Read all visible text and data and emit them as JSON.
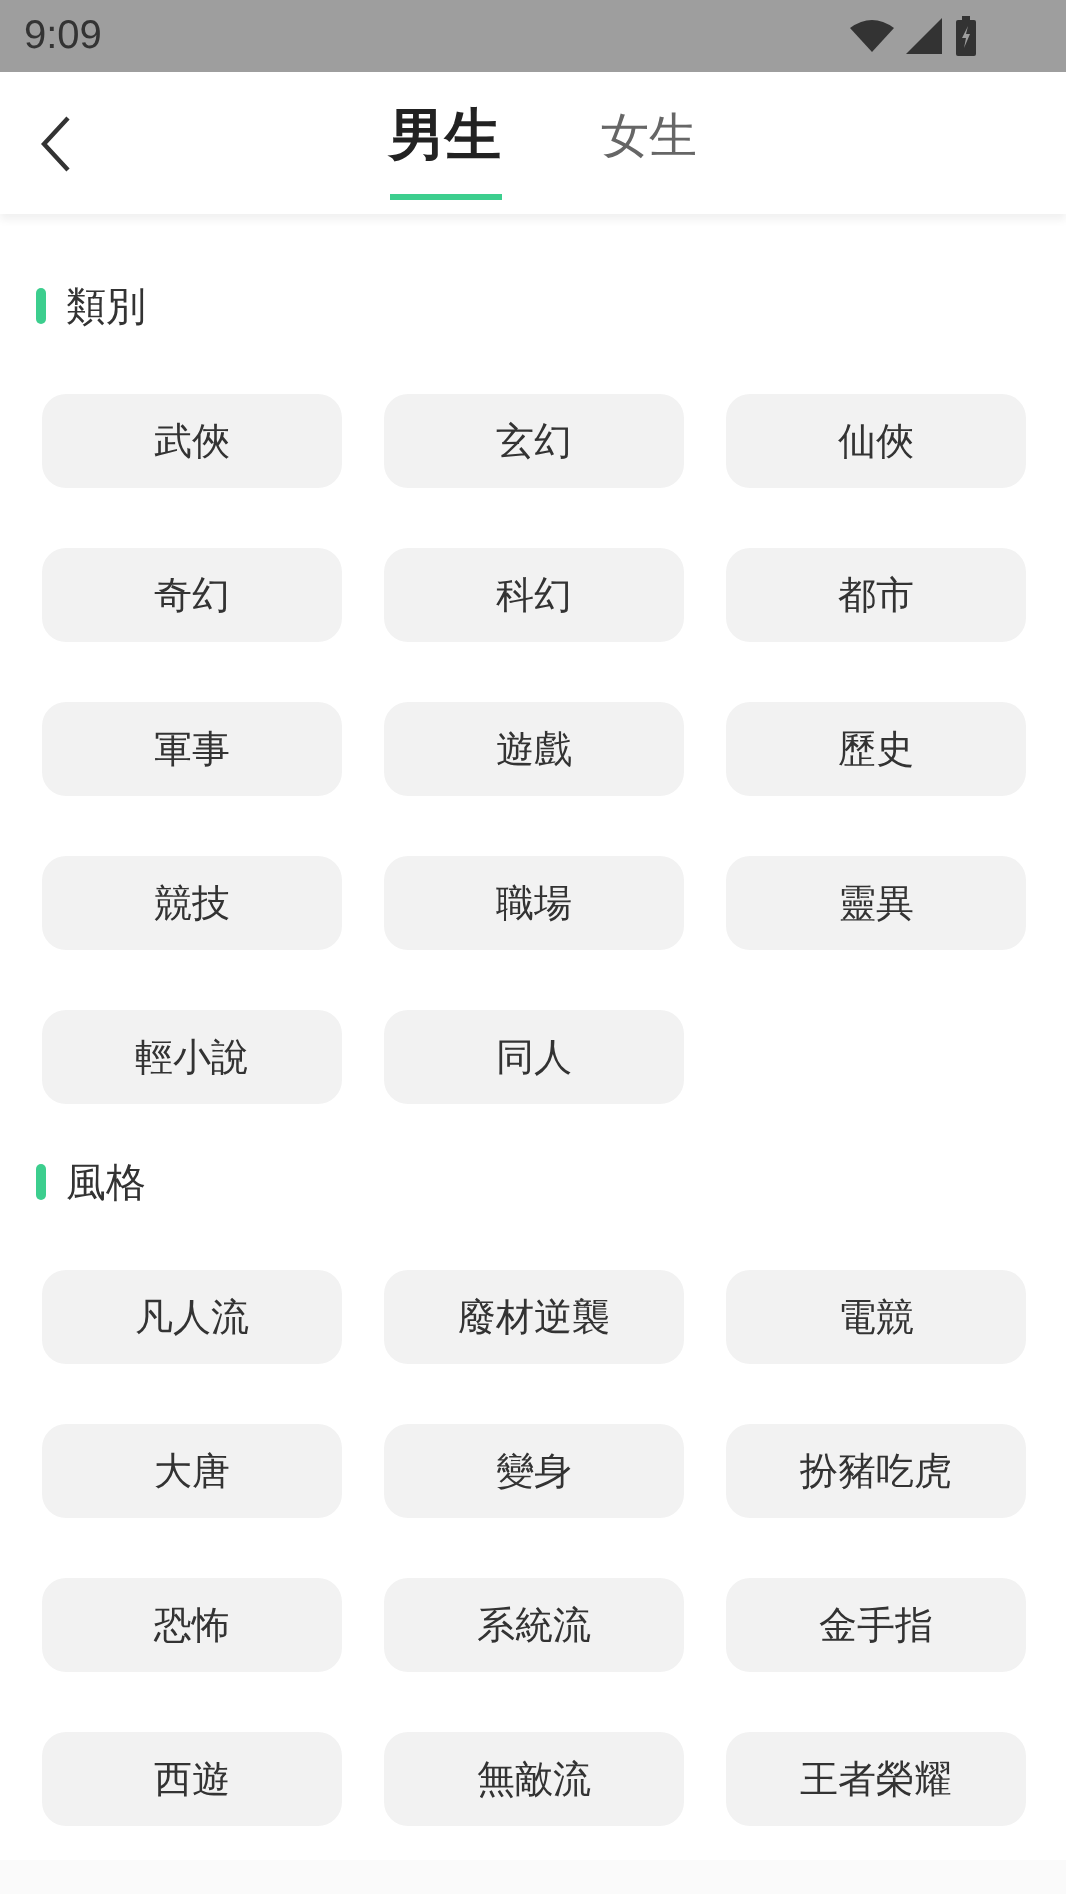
{
  "status_bar": {
    "time": "9:09"
  },
  "tabs": [
    {
      "label": "男生",
      "selected": true
    },
    {
      "label": "女生",
      "selected": false
    }
  ],
  "sections": [
    {
      "title": "類別",
      "tags": [
        "武俠",
        "玄幻",
        "仙俠",
        "奇幻",
        "科幻",
        "都市",
        "軍事",
        "遊戲",
        "歷史",
        "競技",
        "職場",
        "靈異",
        "輕小說",
        "同人"
      ]
    },
    {
      "title": "風格",
      "tags": [
        "凡人流",
        "廢材逆襲",
        "電競",
        "大唐",
        "變身",
        "扮豬吃虎",
        "恐怖",
        "系統流",
        "金手指",
        "西遊",
        "無敵流",
        "王者榮耀"
      ]
    }
  ]
}
